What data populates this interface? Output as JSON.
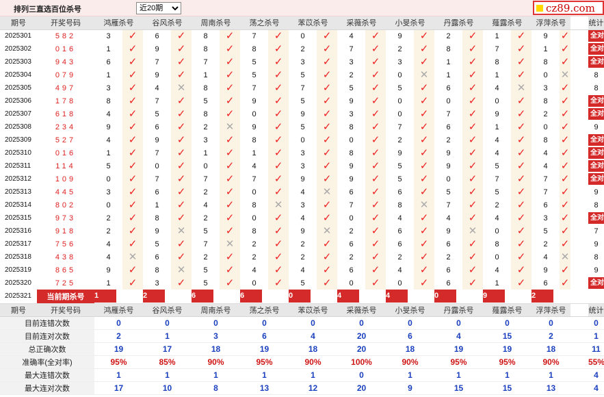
{
  "header": {
    "title": "排列三直选百位杀号",
    "period_select": {
      "selected": "近20期",
      "options": [
        "近20期"
      ]
    },
    "logo_text": "cz89.com"
  },
  "columns": {
    "period": "期号",
    "draw": "开奖号码",
    "methods": [
      "鸿雁杀号",
      "谷风杀号",
      "周南杀号",
      "荡之杀号",
      "苯苡杀号",
      "采薇杀号",
      "小旻杀号",
      "丹露杀号",
      "薤露杀号",
      "浮萍杀号"
    ],
    "total": "统计"
  },
  "rows": [
    {
      "period": "2025301",
      "draw": "582",
      "kills": [
        "3",
        "6",
        "8",
        "7",
        "0",
        "4",
        "9",
        "2",
        "1",
        "9"
      ],
      "hits": [
        1,
        1,
        1,
        1,
        1,
        1,
        1,
        1,
        1,
        1
      ],
      "total": "全对"
    },
    {
      "period": "2025302",
      "draw": "016",
      "kills": [
        "1",
        "9",
        "8",
        "8",
        "2",
        "7",
        "2",
        "8",
        "7",
        "1"
      ],
      "hits": [
        1,
        1,
        1,
        1,
        1,
        1,
        1,
        1,
        1,
        1
      ],
      "total": "全对"
    },
    {
      "period": "2025303",
      "draw": "943",
      "kills": [
        "6",
        "7",
        "7",
        "5",
        "3",
        "3",
        "3",
        "1",
        "8",
        "8"
      ],
      "hits": [
        1,
        1,
        1,
        1,
        1,
        1,
        1,
        1,
        1,
        1
      ],
      "total": "全对"
    },
    {
      "period": "2025304",
      "draw": "079",
      "kills": [
        "1",
        "9",
        "1",
        "5",
        "5",
        "2",
        "0",
        "1",
        "1",
        "0"
      ],
      "hits": [
        1,
        1,
        1,
        1,
        1,
        1,
        0,
        1,
        1,
        0
      ],
      "total": "8"
    },
    {
      "period": "2025305",
      "draw": "497",
      "kills": [
        "3",
        "4",
        "8",
        "7",
        "7",
        "5",
        "5",
        "6",
        "4",
        "3"
      ],
      "hits": [
        1,
        0,
        1,
        1,
        1,
        1,
        1,
        1,
        0,
        1
      ],
      "total": "8"
    },
    {
      "period": "2025306",
      "draw": "178",
      "kills": [
        "8",
        "7",
        "5",
        "9",
        "5",
        "9",
        "0",
        "0",
        "0",
        "8"
      ],
      "hits": [
        1,
        1,
        1,
        1,
        1,
        1,
        1,
        1,
        1,
        1
      ],
      "total": "全对"
    },
    {
      "period": "2025307",
      "draw": "618",
      "kills": [
        "4",
        "5",
        "8",
        "0",
        "9",
        "3",
        "0",
        "7",
        "9",
        "2"
      ],
      "hits": [
        1,
        1,
        1,
        1,
        1,
        1,
        1,
        1,
        1,
        1
      ],
      "total": "全对"
    },
    {
      "period": "2025308",
      "draw": "234",
      "kills": [
        "9",
        "6",
        "2",
        "9",
        "5",
        "8",
        "7",
        "6",
        "1",
        "0"
      ],
      "hits": [
        1,
        1,
        0,
        1,
        1,
        1,
        1,
        1,
        1,
        1
      ],
      "total": "9"
    },
    {
      "period": "2025309",
      "draw": "527",
      "kills": [
        "4",
        "9",
        "3",
        "8",
        "0",
        "0",
        "2",
        "2",
        "4",
        "8"
      ],
      "hits": [
        1,
        1,
        1,
        1,
        1,
        1,
        1,
        1,
        1,
        1
      ],
      "total": "全对"
    },
    {
      "period": "2025310",
      "draw": "016",
      "kills": [
        "1",
        "7",
        "1",
        "1",
        "3",
        "8",
        "9",
        "9",
        "4",
        "4"
      ],
      "hits": [
        1,
        1,
        1,
        1,
        1,
        1,
        1,
        1,
        1,
        1
      ],
      "total": "全对"
    },
    {
      "period": "2025311",
      "draw": "114",
      "kills": [
        "5",
        "0",
        "0",
        "4",
        "3",
        "9",
        "5",
        "9",
        "5",
        "4"
      ],
      "hits": [
        1,
        1,
        1,
        1,
        1,
        1,
        1,
        1,
        1,
        1
      ],
      "total": "全对"
    },
    {
      "period": "2025312",
      "draw": "109",
      "kills": [
        "0",
        "7",
        "7",
        "7",
        "9",
        "9",
        "5",
        "0",
        "7",
        "7"
      ],
      "hits": [
        1,
        1,
        1,
        1,
        1,
        1,
        1,
        1,
        1,
        1
      ],
      "total": "全对"
    },
    {
      "period": "2025313",
      "draw": "445",
      "kills": [
        "3",
        "6",
        "2",
        "0",
        "4",
        "6",
        "6",
        "5",
        "5",
        "7"
      ],
      "hits": [
        1,
        1,
        1,
        1,
        0,
        1,
        1,
        1,
        1,
        1
      ],
      "total": "9"
    },
    {
      "period": "2025314",
      "draw": "802",
      "kills": [
        "0",
        "1",
        "4",
        "8",
        "3",
        "7",
        "8",
        "7",
        "2",
        "6"
      ],
      "hits": [
        1,
        1,
        1,
        0,
        1,
        1,
        0,
        1,
        1,
        1
      ],
      "total": "8"
    },
    {
      "period": "2025315",
      "draw": "973",
      "kills": [
        "2",
        "8",
        "2",
        "0",
        "4",
        "0",
        "4",
        "4",
        "4",
        "3"
      ],
      "hits": [
        1,
        1,
        1,
        1,
        1,
        1,
        1,
        1,
        1,
        1
      ],
      "total": "全对"
    },
    {
      "period": "2025316",
      "draw": "918",
      "kills": [
        "2",
        "9",
        "5",
        "8",
        "9",
        "2",
        "6",
        "9",
        "0",
        "5"
      ],
      "hits": [
        1,
        0,
        1,
        1,
        0,
        1,
        1,
        0,
        1,
        1
      ],
      "total": "7"
    },
    {
      "period": "2025317",
      "draw": "756",
      "kills": [
        "4",
        "5",
        "7",
        "2",
        "2",
        "6",
        "6",
        "6",
        "8",
        "2"
      ],
      "hits": [
        1,
        1,
        0,
        1,
        1,
        1,
        1,
        1,
        1,
        1
      ],
      "total": "9"
    },
    {
      "period": "2025318",
      "draw": "438",
      "kills": [
        "4",
        "6",
        "2",
        "2",
        "2",
        "2",
        "2",
        "2",
        "0",
        "4"
      ],
      "hits": [
        0,
        1,
        1,
        1,
        1,
        1,
        1,
        1,
        1,
        0
      ],
      "total": "8"
    },
    {
      "period": "2025319",
      "draw": "865",
      "kills": [
        "9",
        "8",
        "5",
        "4",
        "4",
        "6",
        "4",
        "6",
        "4",
        "9"
      ],
      "hits": [
        1,
        0,
        1,
        1,
        1,
        1,
        1,
        1,
        1,
        1
      ],
      "total": "9"
    },
    {
      "period": "2025320",
      "draw": "725",
      "kills": [
        "1",
        "3",
        "5",
        "0",
        "5",
        "0",
        "0",
        "6",
        "1",
        "6"
      ],
      "hits": [
        1,
        1,
        1,
        1,
        1,
        1,
        1,
        1,
        1,
        1
      ],
      "total": "全对"
    }
  ],
  "current": {
    "period": "2025321",
    "label": "当前期杀号",
    "kills": [
      "1",
      "2",
      "6",
      "6",
      "0",
      "4",
      "4",
      "0",
      "9",
      "2"
    ]
  },
  "stats": [
    {
      "label": "目前连错次数",
      "values": [
        "0",
        "0",
        "0",
        "0",
        "0",
        "0",
        "0",
        "0",
        "0",
        "0"
      ],
      "total": "0",
      "color": "blue"
    },
    {
      "label": "目前连对次数",
      "values": [
        "2",
        "1",
        "3",
        "6",
        "4",
        "20",
        "6",
        "4",
        "15",
        "2"
      ],
      "total": "1",
      "color": "blue"
    },
    {
      "label": "总正确次数",
      "values": [
        "19",
        "17",
        "18",
        "19",
        "18",
        "20",
        "18",
        "19",
        "19",
        "18"
      ],
      "total": "11",
      "color": "blue"
    },
    {
      "label": "准确率(全对率)",
      "values": [
        "95%",
        "85%",
        "90%",
        "95%",
        "90%",
        "100%",
        "90%",
        "95%",
        "95%",
        "90%"
      ],
      "total": "55%",
      "color": "red"
    },
    {
      "label": "最大连错次数",
      "values": [
        "1",
        "1",
        "1",
        "1",
        "1",
        "0",
        "1",
        "1",
        "1",
        "1"
      ],
      "total": "4",
      "color": "blue"
    },
    {
      "label": "最大连对次数",
      "values": [
        "17",
        "10",
        "8",
        "13",
        "12",
        "20",
        "9",
        "15",
        "15",
        "13"
      ],
      "total": "4",
      "color": "blue"
    }
  ],
  "icons": {
    "hit": "check-icon",
    "miss": "cross-icon"
  },
  "colors": {
    "accent_red": "#d42a2a",
    "check_red": "#ee2020",
    "stat_blue": "#1a3fbf",
    "mark_bg": "#fbf3e4"
  }
}
